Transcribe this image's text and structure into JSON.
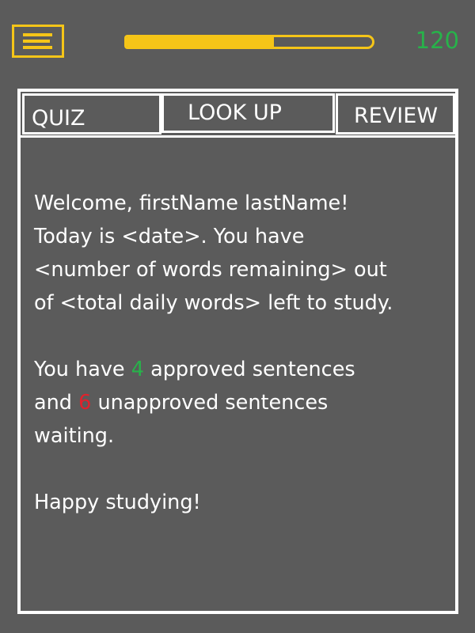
{
  "header": {
    "menu_icon": "hamburger-menu-icon",
    "progress_percent": 60,
    "score": "120",
    "accent_color": "#f5c518",
    "score_color": "#27b34a"
  },
  "tabs": [
    {
      "label": "QUIZ"
    },
    {
      "label": "LOOK UP"
    },
    {
      "label": "REVIEW"
    }
  ],
  "content": {
    "welcome_line": "Welcome, firstName lastName!",
    "today_line": "Today is <date>. You have",
    "remaining_line": "<number of words remaining> out",
    "total_line": "of <total daily words> left to study.",
    "approved_prefix": "You have",
    "approved_count": "4",
    "approved_suffix": "approved sentences",
    "unapproved_prefix": "and",
    "unapproved_count": "6",
    "unapproved_suffix": "unapproved sentences",
    "waiting_line": "waiting.",
    "closing": "Happy studying!",
    "approved_color": "#27b34a",
    "unapproved_color": "#e3212b"
  }
}
